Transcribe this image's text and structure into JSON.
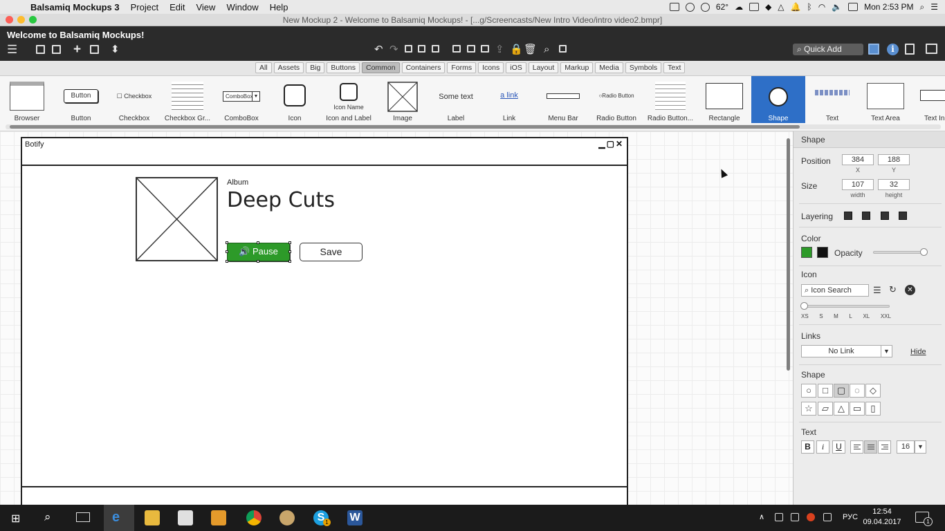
{
  "mac_menu": {
    "app_name": "Balsamiq Mockups 3",
    "items": [
      "Project",
      "Edit",
      "View",
      "Window",
      "Help"
    ],
    "temperature": "62°",
    "clock": "Mon 2:53 PM"
  },
  "window": {
    "title": "New Mockup 2 - Welcome to Balsamiq Mockups! - [...g/Screencasts/New Intro Video/intro video2.bmpr]"
  },
  "app": {
    "welcome": "Welcome to Balsamiq Mockups!",
    "quick_add_placeholder": "Quick Add"
  },
  "filter_tabs": [
    {
      "label": "All",
      "active": false
    },
    {
      "label": "Assets",
      "active": false
    },
    {
      "label": "Big",
      "active": false
    },
    {
      "label": "Buttons",
      "active": false
    },
    {
      "label": "Common",
      "active": true
    },
    {
      "label": "Containers",
      "active": false
    },
    {
      "label": "Forms",
      "active": false
    },
    {
      "label": "Icons",
      "active": false
    },
    {
      "label": "iOS",
      "active": false
    },
    {
      "label": "Layout",
      "active": false
    },
    {
      "label": "Markup",
      "active": false
    },
    {
      "label": "Media",
      "active": false
    },
    {
      "label": "Symbols",
      "active": false
    },
    {
      "label": "Text",
      "active": false
    }
  ],
  "library": {
    "items": [
      "Browser",
      "Button",
      "Checkbox",
      "Checkbox Gr...",
      "ComboBox",
      "Icon",
      "Icon and Label",
      "Image",
      "Label",
      "Link",
      "Menu Bar",
      "Radio Button",
      "Radio Button...",
      "Rectangle",
      "Shape",
      "Text",
      "Text Area",
      "Text In"
    ],
    "selected": "Shape",
    "previews": {
      "button": "Button",
      "checkbox": "Checkbox",
      "combobox": "ComboBox",
      "icon_label": "Icon Name",
      "label": "Some text",
      "link": "a link",
      "radio": "Radio Button"
    }
  },
  "mockup": {
    "window_title": "Botify",
    "window_controls": "▁▢✕",
    "album_label": "Album",
    "album_title": "Deep Cuts",
    "pause_label": "🔊 Pause",
    "save_label": "Save"
  },
  "inspector": {
    "header": "Shape",
    "position_label": "Position",
    "x": "384",
    "y": "188",
    "x_cap": "X",
    "y_cap": "Y",
    "size_label": "Size",
    "width": "107",
    "height": "32",
    "width_cap": "width",
    "height_cap": "height",
    "layering_label": "Layering",
    "color_label": "Color",
    "fill_color": "#2d9a29",
    "border_color": "#111111",
    "opacity_label": "Opacity",
    "opacity_value": 1.0,
    "icon_label": "Icon",
    "icon_search_placeholder": "Icon Search",
    "icon_sizes": [
      "XS",
      "S",
      "M",
      "L",
      "XL",
      "XXL"
    ],
    "links_label": "Links",
    "link_value": "No Link",
    "hide_label": "Hide",
    "shape_label": "Shape",
    "text_label": "Text",
    "bold": "B",
    "italic": "i",
    "underline": "U",
    "font_size": "16"
  },
  "taskbar": {
    "lang": "РУС",
    "time": "12:54",
    "date": "09.04.2017",
    "notifications": "1",
    "skype_badge": "1"
  },
  "colors": {
    "selection": "#2e6fc7",
    "pause_fill": "#2d9a29"
  }
}
